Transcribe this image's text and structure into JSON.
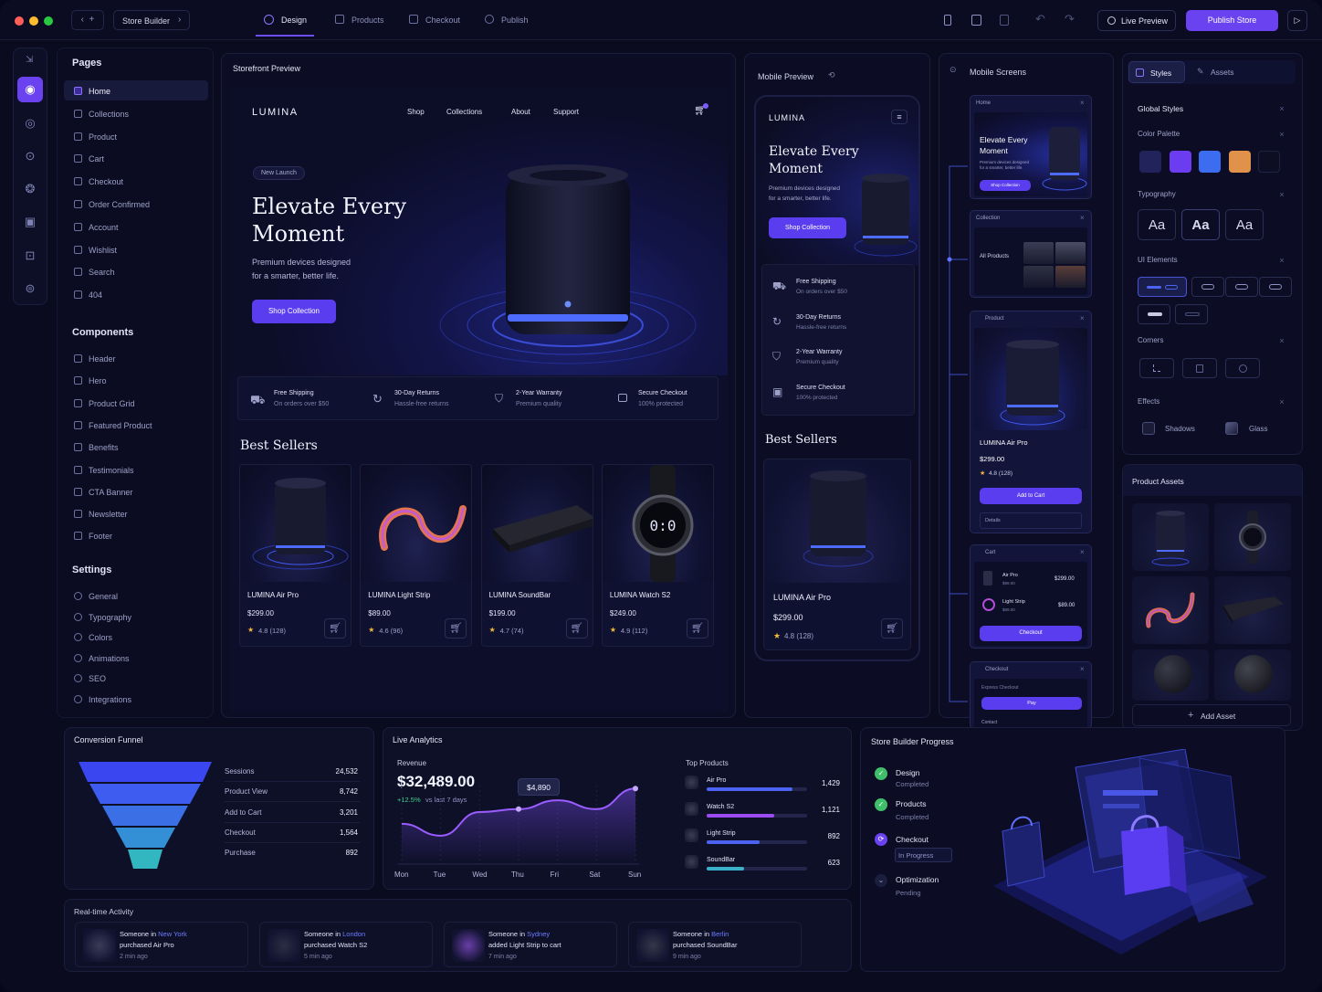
{
  "titlebar": {
    "project": "Store Builder",
    "tabs": [
      "Design",
      "Products",
      "Checkout",
      "Publish"
    ],
    "active_tab": "Design",
    "live_preview": "Live Preview",
    "publish": "Publish Store"
  },
  "sidebar": {
    "pages_title": "Pages",
    "pages": [
      "Home",
      "Collections",
      "Product",
      "Cart",
      "Checkout",
      "Order Confirmed",
      "Account",
      "Wishlist",
      "Search",
      "404"
    ],
    "components_title": "Components",
    "components": [
      "Header",
      "Hero",
      "Product Grid",
      "Featured Product",
      "Benefits",
      "Testimonials",
      "CTA Banner",
      "Newsletter",
      "Footer"
    ],
    "settings_title": "Settings",
    "settings": [
      "General",
      "Typography",
      "Colors",
      "Animations",
      "SEO",
      "Integrations"
    ]
  },
  "storefront": {
    "title": "Storefront Preview",
    "brand": "LUMINA",
    "nav": [
      "Shop",
      "Collections",
      "About",
      "Support"
    ],
    "badge": "New Launch",
    "hero_title_1": "Elevate Every",
    "hero_title_2": "Moment",
    "hero_sub_1": "Premium devices designed",
    "hero_sub_2": "for a smarter, better life.",
    "cta": "Shop Collection",
    "benefits": [
      {
        "title": "Free Shipping",
        "sub": "On orders over $50"
      },
      {
        "title": "30-Day Returns",
        "sub": "Hassle-free returns"
      },
      {
        "title": "2-Year Warranty",
        "sub": "Premium quality"
      },
      {
        "title": "Secure Checkout",
        "sub": "100% protected"
      }
    ],
    "best_sellers": "Best Sellers",
    "products": [
      {
        "name": "LUMINA Air Pro",
        "price": "$299.00",
        "rating": "4.8 (128)"
      },
      {
        "name": "LUMINA Light Strip",
        "price": "$89.00",
        "rating": "4.6 (96)"
      },
      {
        "name": "LUMINA SoundBar",
        "price": "$199.00",
        "rating": "4.7 (74)"
      },
      {
        "name": "LUMINA Watch S2",
        "price": "$249.00",
        "rating": "4.9 (112)"
      }
    ]
  },
  "mobile": {
    "title": "Mobile Preview",
    "brand": "LUMINA",
    "hero_title_1": "Elevate Every",
    "hero_title_2": "Moment",
    "hero_sub_1": "Premium devices designed",
    "hero_sub_2": "for a smarter, better life.",
    "cta": "Shop Collection",
    "benefits": [
      {
        "title": "Free Shipping",
        "sub": "On orders over $50"
      },
      {
        "title": "30-Day Returns",
        "sub": "Hassle-free returns"
      },
      {
        "title": "2-Year Warranty",
        "sub": "Premium quality"
      },
      {
        "title": "Secure Checkout",
        "sub": "100% protected"
      }
    ],
    "best_sellers": "Best Sellers",
    "product_name": "LUMINA Air Pro",
    "product_price": "$299.00",
    "product_rating": "4.8 (128)"
  },
  "screens": {
    "title": "Mobile Screens",
    "home": {
      "label": "Home",
      "title_1": "Elevate Every",
      "title_2": "Moment",
      "sub": "Premium devices designed for a smarter, better life.",
      "cta": "Shop Collection"
    },
    "collection": {
      "label": "Collection",
      "all": "All Products"
    },
    "product": {
      "label": "Product",
      "name": "LUMINA Air Pro",
      "price": "$299.00",
      "rating": "4.8 (128)",
      "add": "Add to Cart",
      "details": "Details"
    },
    "cart": {
      "label": "Cart",
      "item1": "Air Pro",
      "item1_sub": "$99.00",
      "item1_price": "$299.00",
      "item2": "Light Strip",
      "item2_sub": "$89.00",
      "item2_price": "$89.00",
      "checkout": "Checkout"
    },
    "checkout": {
      "label": "Checkout",
      "express": "Express Checkout",
      "pay": "Pay",
      "contact": "Contact"
    }
  },
  "styles": {
    "tab_styles": "Styles",
    "tab_assets": "Assets",
    "global": "Global Styles",
    "palette": "Color Palette",
    "palette_colors": [
      "#23235c",
      "#6b3cf0",
      "#3c6df0",
      "#e0924a",
      "#0d0e24"
    ],
    "typography": "Typography",
    "aa": "Aa",
    "ui_elements": "UI Elements",
    "corners": "Corners",
    "effects": "Effects",
    "shadows": "Shadows",
    "glass": "Glass"
  },
  "assets": {
    "title": "Product Assets",
    "add": "Add Asset"
  },
  "funnel": {
    "title": "Conversion Funnel",
    "rows": [
      {
        "label": "Sessions",
        "value": "24,532"
      },
      {
        "label": "Product View",
        "value": "8,742"
      },
      {
        "label": "Add to Cart",
        "value": "3,201"
      },
      {
        "label": "Checkout",
        "value": "1,564"
      },
      {
        "label": "Purchase",
        "value": "892"
      }
    ]
  },
  "analytics": {
    "title": "Live Analytics",
    "revenue_label": "Revenue",
    "revenue": "$32,489.00",
    "delta": "+12.5%",
    "delta_note": "vs last 7 days",
    "tooltip": "$4,890",
    "days": [
      "Mon",
      "Tue",
      "Wed",
      "Thu",
      "Fri",
      "Sat",
      "Sun"
    ],
    "top_title": "Top Products",
    "top": [
      {
        "name": "Air Pro",
        "value": "1,429",
        "fill": 0.85,
        "color": "#4b63f0"
      },
      {
        "name": "Watch S2",
        "value": "1,121",
        "fill": 0.67,
        "color": "#9a4cf0"
      },
      {
        "name": "Light Strip",
        "value": "892",
        "fill": 0.53,
        "color": "#4b63f0"
      },
      {
        "name": "SoundBar",
        "value": "623",
        "fill": 0.37,
        "color": "#3bb0c9"
      }
    ]
  },
  "chart_data": {
    "type": "line",
    "categories": [
      "Mon",
      "Tue",
      "Wed",
      "Thu",
      "Fri",
      "Sat",
      "Sun"
    ],
    "values": [
      0.35,
      0.15,
      0.55,
      0.6,
      0.75,
      0.6,
      0.95
    ],
    "title": "Revenue"
  },
  "progress": {
    "title": "Store Builder Progress",
    "steps": [
      {
        "name": "Design",
        "status": "Completed"
      },
      {
        "name": "Products",
        "status": "Completed"
      },
      {
        "name": "Checkout",
        "status": "In Progress"
      },
      {
        "name": "Optimization",
        "status": "Pending"
      }
    ]
  },
  "activity": {
    "title": "Real-time Activity",
    "items": [
      {
        "who": "Someone in ",
        "city": "New York",
        "action": "purchased Air Pro",
        "time": "2 min ago"
      },
      {
        "who": "Someone in ",
        "city": "London",
        "action": "purchased Watch S2",
        "time": "5 min ago"
      },
      {
        "who": "Someone in ",
        "city": "Sydney",
        "action": "added Light Strip to cart",
        "time": "7 min ago"
      },
      {
        "who": "Someone in ",
        "city": "Berlin",
        "action": "purchased SoundBar",
        "time": "9 min ago"
      }
    ]
  }
}
